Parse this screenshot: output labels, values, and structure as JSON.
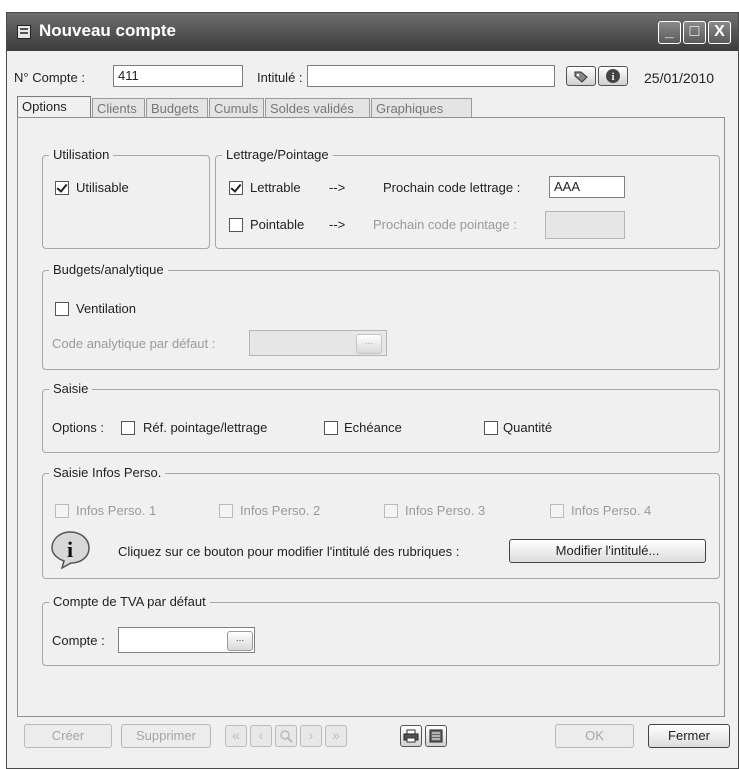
{
  "window": {
    "title": "Nouveau compte",
    "minimize": "_",
    "maximize": "□",
    "close": "X"
  },
  "header": {
    "compte_label": "N° Compte :",
    "compte_value": "411",
    "intitule_label": "Intitulé :",
    "intitule_value": "",
    "date": "25/01/2010"
  },
  "tabs": [
    "Options",
    "Clients",
    "Budgets",
    "Cumuls",
    "Soldes validés",
    "Graphiques"
  ],
  "utilisation": {
    "legend": "Utilisation",
    "utilisable_label": "Utilisable",
    "utilisable_checked": true
  },
  "lettrage": {
    "legend": "Lettrage/Pointage",
    "lettrable_label": "Lettrable",
    "lettrable_checked": true,
    "arrow": "-->",
    "prochain_lettrage_label": "Prochain code lettrage :",
    "prochain_lettrage_value": "AAA",
    "pointable_label": "Pointable",
    "pointable_checked": false,
    "prochain_pointage_label": "Prochain code pointage :",
    "prochain_pointage_value": ""
  },
  "budgets": {
    "legend": "Budgets/analytique",
    "ventilation_label": "Ventilation",
    "code_label": "Code analytique par défaut :",
    "code_value": "",
    "dots": "..."
  },
  "saisie": {
    "legend": "Saisie",
    "options_label": "Options :",
    "ref_label": "Réf. pointage/lettrage",
    "echeance_label": "Echéance",
    "quantite_label": "Quantité"
  },
  "infos": {
    "legend": "Saisie Infos Perso.",
    "items": [
      "Infos Perso. 1",
      "Infos Perso. 2",
      "Infos Perso. 3",
      "Infos Perso. 4"
    ],
    "message": "Cliquez sur ce bouton pour modifier l'intitulé des rubriques :",
    "modifier_button": "Modifier l'intitulé...",
    "info_icon": "i"
  },
  "tva": {
    "legend": "Compte de TVA par défaut",
    "compte_label": "Compte :",
    "compte_value": "",
    "dots": "..."
  },
  "footer": {
    "creer": "Créer",
    "supprimer": "Supprimer",
    "ok": "OK",
    "fermer": "Fermer"
  }
}
